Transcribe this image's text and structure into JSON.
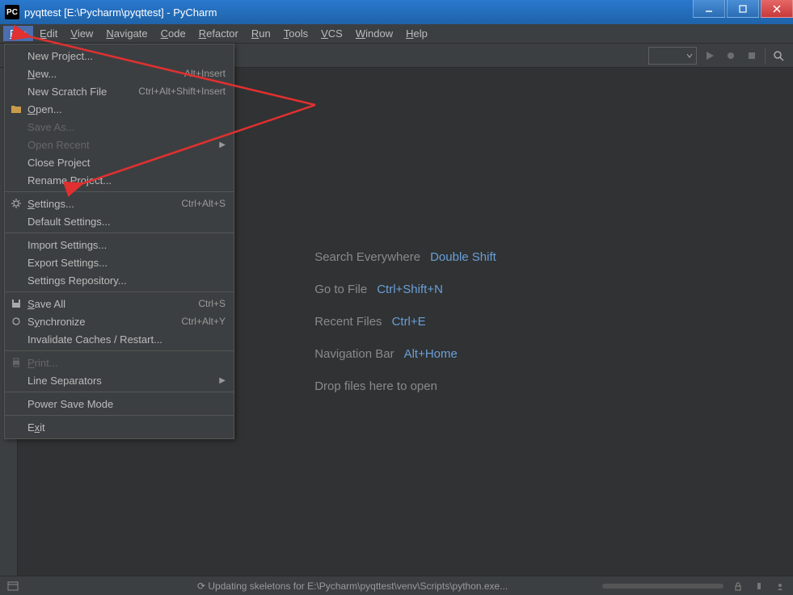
{
  "title": "pyqttest [E:\\Pycharm\\pyqttest] - PyCharm",
  "app_icon_text": "PC",
  "menubar": [
    "File",
    "Edit",
    "View",
    "Navigate",
    "Code",
    "Refactor",
    "Run",
    "Tools",
    "VCS",
    "Window",
    "Help"
  ],
  "file_menu": {
    "groups": [
      [
        {
          "label": "New Project...",
          "shortcut": "",
          "icon": "",
          "disabled": false,
          "ul": ""
        },
        {
          "label": "New...",
          "shortcut": "Alt+Insert",
          "icon": "",
          "disabled": false,
          "ul": "N"
        },
        {
          "label": "New Scratch File",
          "shortcut": "Ctrl+Alt+Shift+Insert",
          "icon": "",
          "disabled": false,
          "ul": ""
        },
        {
          "label": "Open...",
          "shortcut": "",
          "icon": "folder",
          "disabled": false,
          "ul": "O"
        },
        {
          "label": "Save As...",
          "shortcut": "",
          "icon": "",
          "disabled": true,
          "ul": ""
        },
        {
          "label": "Open Recent",
          "shortcut": "",
          "icon": "",
          "disabled": true,
          "submenu": true,
          "ul": ""
        },
        {
          "label": "Close Project",
          "shortcut": "",
          "icon": "",
          "disabled": false,
          "ul": ""
        },
        {
          "label": "Rename Project...",
          "shortcut": "",
          "icon": "",
          "disabled": false,
          "ul": ""
        }
      ],
      [
        {
          "label": "Settings...",
          "shortcut": "Ctrl+Alt+S",
          "icon": "gear",
          "disabled": false,
          "ul": "S"
        },
        {
          "label": "Default Settings...",
          "shortcut": "",
          "icon": "",
          "disabled": false,
          "ul": ""
        }
      ],
      [
        {
          "label": "Import Settings...",
          "shortcut": "",
          "icon": "",
          "disabled": false,
          "ul": ""
        },
        {
          "label": "Export Settings...",
          "shortcut": "",
          "icon": "",
          "disabled": false,
          "ul": ""
        },
        {
          "label": "Settings Repository...",
          "shortcut": "",
          "icon": "",
          "disabled": false,
          "ul": ""
        }
      ],
      [
        {
          "label": "Save All",
          "shortcut": "Ctrl+S",
          "icon": "save",
          "disabled": false,
          "ul": "S"
        },
        {
          "label": "Synchronize",
          "shortcut": "Ctrl+Alt+Y",
          "icon": "sync",
          "disabled": false,
          "ul": "y"
        },
        {
          "label": "Invalidate Caches / Restart...",
          "shortcut": "",
          "icon": "",
          "disabled": false,
          "ul": ""
        }
      ],
      [
        {
          "label": "Print...",
          "shortcut": "",
          "icon": "print",
          "disabled": true,
          "ul": "P"
        },
        {
          "label": "Line Separators",
          "shortcut": "",
          "icon": "",
          "disabled": false,
          "submenu": true,
          "ul": ""
        }
      ],
      [
        {
          "label": "Power Save Mode",
          "shortcut": "",
          "icon": "",
          "disabled": false,
          "ul": ""
        }
      ],
      [
        {
          "label": "Exit",
          "shortcut": "",
          "icon": "",
          "disabled": false,
          "ul": "x"
        }
      ]
    ]
  },
  "welcome": [
    {
      "label": "Search Everywhere",
      "key": "Double Shift"
    },
    {
      "label": "Go to File",
      "key": "Ctrl+Shift+N"
    },
    {
      "label": "Recent Files",
      "key": "Ctrl+E"
    },
    {
      "label": "Navigation Bar",
      "key": "Alt+Home"
    },
    {
      "label": "Drop files here to open",
      "key": ""
    }
  ],
  "status_text": "Updating skeletons for E:\\Pycharm\\pyqttest\\venv\\Scripts\\python.exe..."
}
